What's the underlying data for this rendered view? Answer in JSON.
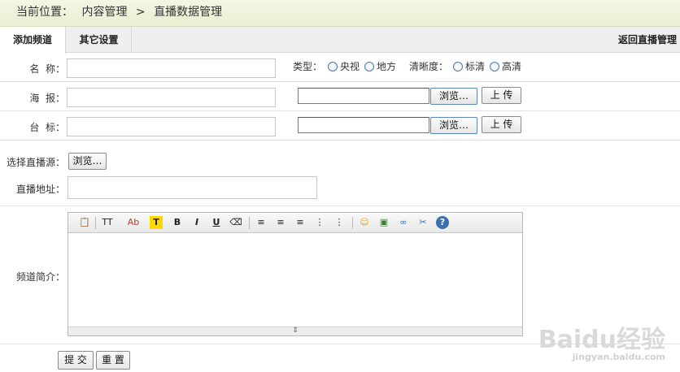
{
  "breadcrumb": {
    "label": "当前位置：",
    "path1": "内容管理",
    "separator": ">",
    "path2": "直播数据管理"
  },
  "tabs": {
    "active": "添加频道",
    "other": "其它设置",
    "back": "返回直播管理"
  },
  "form": {
    "name_label": "名  称：",
    "type_label": "类型：",
    "type_opt1": "央视",
    "type_opt2": "地方",
    "clarity_label": "清晰度：",
    "clarity_opt1": "标清",
    "clarity_opt2": "高清",
    "poster_label": "海  报：",
    "logo_label": "台  标：",
    "browse_label": "浏览…",
    "upload_label": "上 传",
    "source_label": "选择直播源：",
    "url_label": "直播地址：",
    "intro_label": "频道简介：",
    "submit_label": "提 交",
    "reset_label": "重 置"
  },
  "editor": {
    "toolbar": [
      {
        "icon": "paste-icon",
        "glyph": "📋"
      },
      {
        "icon": "font-size-icon",
        "glyph": "TT"
      },
      {
        "icon": "font-color-icon",
        "glyph": "Ab"
      },
      {
        "icon": "highlight-icon",
        "glyph": "T"
      },
      {
        "icon": "bold-icon",
        "glyph": "B"
      },
      {
        "icon": "italic-icon",
        "glyph": "I"
      },
      {
        "icon": "underline-icon",
        "glyph": "U"
      },
      {
        "icon": "eraser-icon",
        "glyph": "⌫"
      },
      {
        "icon": "align-left-icon",
        "glyph": "≡"
      },
      {
        "icon": "align-center-icon",
        "glyph": "≡"
      },
      {
        "icon": "align-right-icon",
        "glyph": "≡"
      },
      {
        "icon": "ordered-list-icon",
        "glyph": "⋮"
      },
      {
        "icon": "unordered-list-icon",
        "glyph": "⋮"
      },
      {
        "icon": "emoticon-icon",
        "glyph": "☺"
      },
      {
        "icon": "image-icon",
        "glyph": "▣"
      },
      {
        "icon": "link-icon",
        "glyph": "∞"
      },
      {
        "icon": "unlink-icon",
        "glyph": "✂"
      },
      {
        "icon": "help-icon",
        "glyph": "?"
      }
    ],
    "resize_glyph": "⇕"
  },
  "watermark": {
    "text": "Baidu经验",
    "sub": "jingyan.baidu.com"
  }
}
